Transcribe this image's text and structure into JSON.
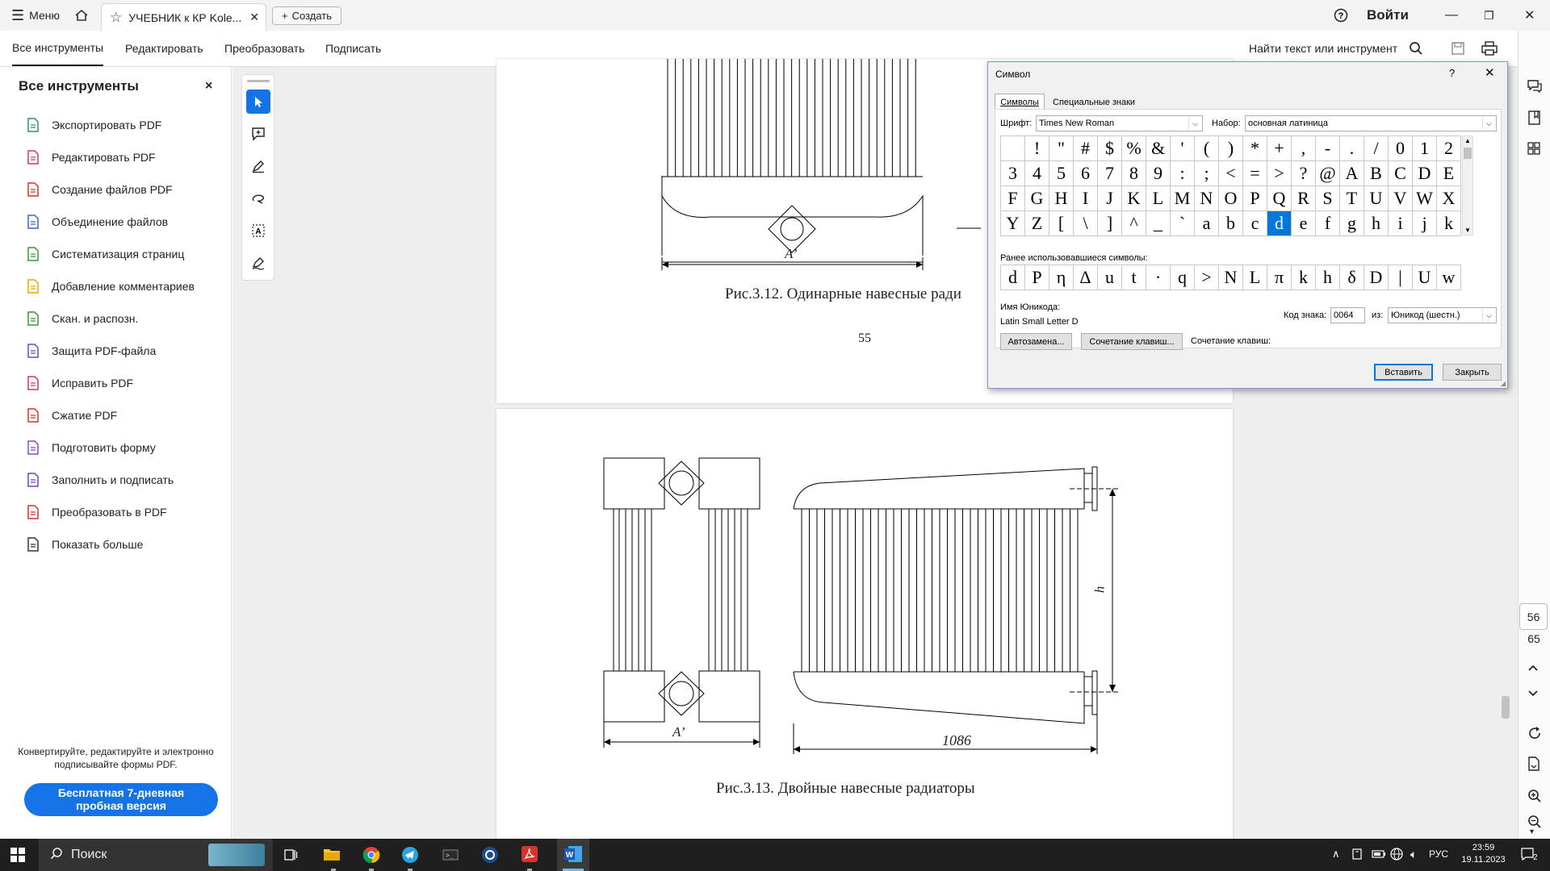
{
  "titlebar": {
    "menu_label": "Меню",
    "tab_title": "УЧЕБНИК к КР Kole...",
    "create_label": "Создать",
    "signin_label": "Войти"
  },
  "menubar": {
    "items": [
      "Все инструменты",
      "Редактировать",
      "Преобразовать",
      "Подписать"
    ],
    "search_label": "Найти текст или инструмент"
  },
  "leftpanel": {
    "title": "Все инструменты",
    "tools": [
      {
        "label": "Экспортировать PDF",
        "icon": "export-pdf-icon",
        "color": "#2d8f8a"
      },
      {
        "label": "Редактировать PDF",
        "icon": "edit-pdf-icon",
        "color": "#d6336c"
      },
      {
        "label": "Создание файлов PDF",
        "icon": "create-pdf-icon",
        "color": "#d9342b"
      },
      {
        "label": "Объединение файлов",
        "icon": "combine-files-icon",
        "color": "#3b63c9"
      },
      {
        "label": "Систематизация страниц",
        "icon": "organize-pages-icon",
        "color": "#3a9a3a"
      },
      {
        "label": "Добавление комментариев",
        "icon": "comment-icon",
        "color": "#e8a500"
      },
      {
        "label": "Скан. и распозн.",
        "icon": "scan-ocr-icon",
        "color": "#3a9a3a"
      },
      {
        "label": "Защита PDF-файла",
        "icon": "protect-pdf-icon",
        "color": "#6a4bc4"
      },
      {
        "label": "Исправить PDF",
        "icon": "redact-pdf-icon",
        "color": "#d6336c"
      },
      {
        "label": "Сжатие PDF",
        "icon": "compress-pdf-icon",
        "color": "#d9342b"
      },
      {
        "label": "Подготовить форму",
        "icon": "prepare-form-icon",
        "color": "#8a4bc4"
      },
      {
        "label": "Заполнить и подписать",
        "icon": "fill-sign-icon",
        "color": "#7a3fbf"
      },
      {
        "label": "Преобразовать в PDF",
        "icon": "convert-pdf-icon",
        "color": "#d9342b"
      },
      {
        "label": "Показать больше",
        "icon": "more-tools-icon",
        "color": "#333333"
      }
    ],
    "promo_text_1": "Конвертируйте, редактируйте и электронно",
    "promo_text_2": "подписывайте формы PDF.",
    "trial_line_1": "Бесплатная 7-дневная",
    "trial_line_2": "пробная версия",
    "accent": "#1473e6"
  },
  "document": {
    "page_number": "55",
    "fig_312_caption": "Рис.3.12. Одинарные навесные ради",
    "fig_313_caption": "Рис.3.13. Двойные навесные радиаторы",
    "dim_a": "A’",
    "dim_1086": "1086",
    "dim_h": "h"
  },
  "rightrail": {
    "page_current": "56",
    "page_total": "65"
  },
  "dialog": {
    "title": "Символ",
    "help": "?",
    "tab_symbols": "Символы",
    "tab_special": "Специальные знаки",
    "font_label": "Шрифт:",
    "font_value": "Times New Roman",
    "subset_label": "Набор:",
    "subset_value": "основная латиница",
    "symbols": [
      " ",
      "!",
      "\"",
      "#",
      "$",
      "%",
      "&",
      "'",
      "(",
      ")",
      "*",
      "+",
      ",",
      "-",
      ".",
      "/",
      "0",
      "1",
      "2",
      "3",
      "4",
      "5",
      "6",
      "7",
      "8",
      "9",
      ":",
      ";",
      "<",
      "=",
      ">",
      "?",
      "@",
      "A",
      "B",
      "C",
      "D",
      "E",
      "F",
      "G",
      "H",
      "I",
      "J",
      "K",
      "L",
      "M",
      "N",
      "O",
      "P",
      "Q",
      "R",
      "S",
      "T",
      "U",
      "V",
      "W",
      "X",
      "Y",
      "Z",
      "[",
      "\\",
      "]",
      "^",
      "_",
      "`",
      "a",
      "b",
      "c",
      "d",
      "e",
      "f",
      "g",
      "h",
      "i",
      "j",
      "k"
    ],
    "selected_symbol": "d",
    "recent_label": "Ранее использовавшиеся символы:",
    "recent": [
      "d",
      "P",
      "η",
      "Δ",
      "u",
      "t",
      "·",
      "q",
      ">",
      "N",
      "L",
      "π",
      "k",
      "h",
      "δ",
      "D",
      "|",
      "U",
      "w"
    ],
    "unicode_name_label": "Имя Юникода:",
    "unicode_name": "Latin Small Letter D",
    "code_label": "Код знака:",
    "code_value": "0064",
    "from_label": "из:",
    "from_value": "Юникод (шестн.)",
    "autocorrect": "Автозамена...",
    "shortcut_btn": "Сочетание клавиш...",
    "shortcut_label": "Сочетание клавиш:",
    "insert": "Вставить",
    "close": "Закрыть"
  },
  "taskbar": {
    "search_placeholder": "Поиск",
    "lang": "РУС",
    "time": "23:59",
    "date": "19.11.2023",
    "notifications": "2"
  }
}
